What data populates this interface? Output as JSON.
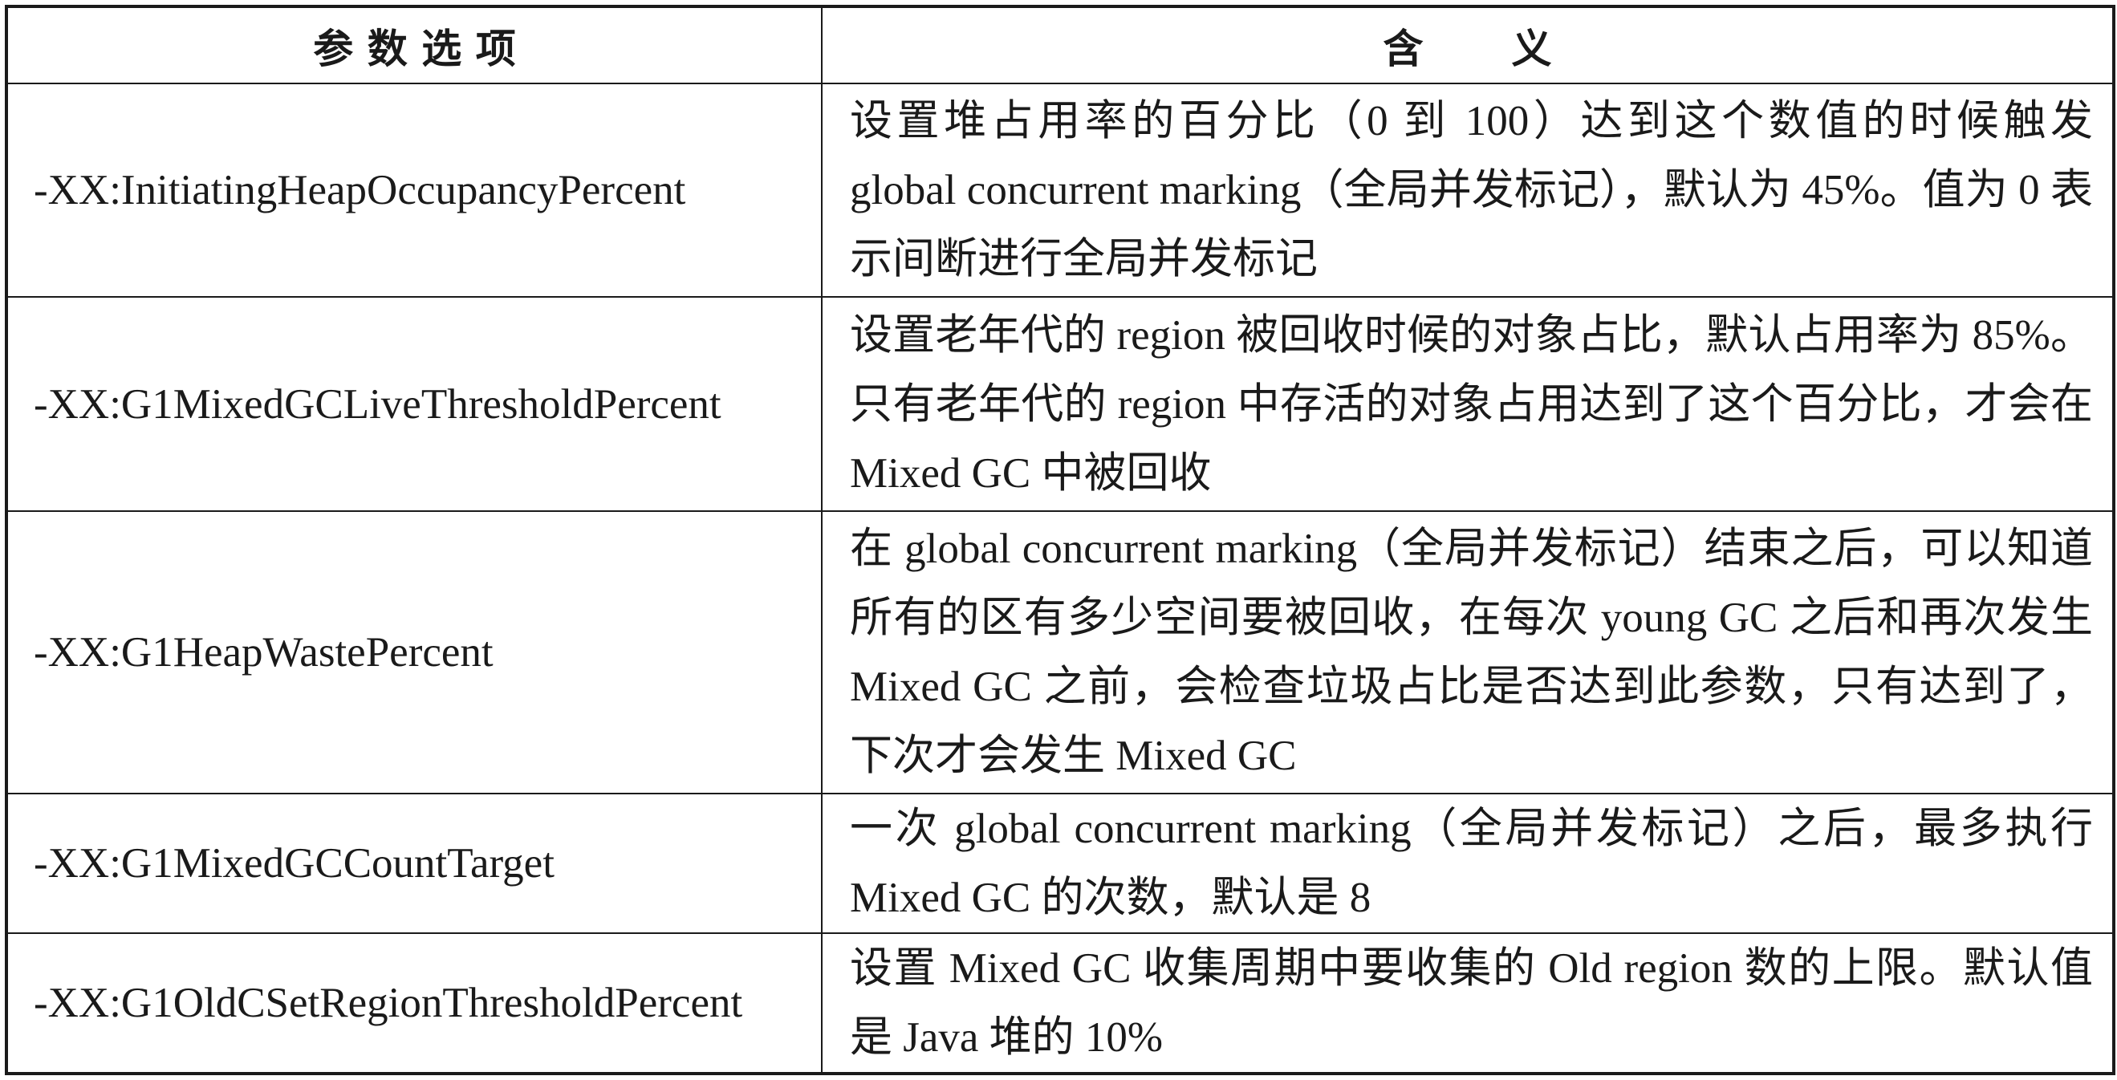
{
  "table": {
    "headers": {
      "option": "参数选项",
      "meaning": "含义"
    },
    "rows": [
      {
        "option": "-XX:InitiatingHeapOccupancyPercent",
        "meaning": "设置堆占用率的百分比（0 到 100）达到这个数值的时候触发 global concurrent marking（全局并发标记），默认为 45%。值为 0 表示间断进行全局并发标记"
      },
      {
        "option": "-XX:G1MixedGCLiveThresholdPercent",
        "meaning": "设置老年代的 region 被回收时候的对象占比，默认占用率为 85%。只有老年代的 region 中存活的对象占用达到了这个百分比，才会在 Mixed GC 中被回收"
      },
      {
        "option": "-XX:G1HeapWastePercent",
        "meaning": "在 global concurrent marking（全局并发标记）结束之后，可以知道所有的区有多少空间要被回收，在每次 young GC 之后和再次发生 Mixed GC 之前，会检查垃圾占比是否达到此参数，只有达到了，下次才会发生 Mixed GC"
      },
      {
        "option": "-XX:G1MixedGCCountTarget",
        "meaning": "一次 global concurrent marking（全局并发标记）之后，最多执行 Mixed GC 的次数，默认是 8"
      },
      {
        "option": "-XX:G1OldCSetRegionThresholdPercent",
        "meaning": "设置 Mixed GC 收集周期中要收集的 Old region 数的上限。默认值是 Java 堆的 10%"
      }
    ]
  }
}
